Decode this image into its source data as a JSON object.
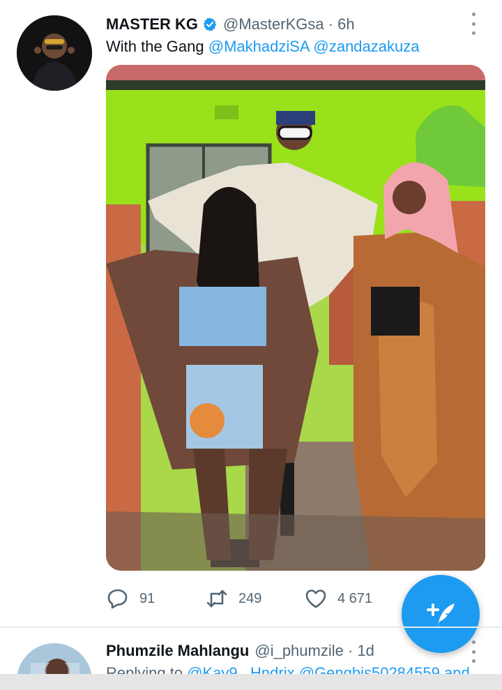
{
  "tweet": {
    "author_name": "MASTER KG",
    "author_handle": "@MasterKGsa · 6h",
    "text_prefix": "With the Gang ",
    "mentions": [
      "@MakhadziSA",
      "@zandazakuza"
    ],
    "stats": {
      "replies": "91",
      "retweets": "249",
      "likes": "4 671"
    }
  },
  "next_tweet": {
    "author_name": "Phumzile Mahlangu",
    "author_handle": "@i_phumzile · 1d",
    "replying_prefix": "Replying to ",
    "replying_to": "@Kay9_ Hndrix @Gengbis50284559 and"
  },
  "colors": {
    "accent": "#1d9bf0",
    "text_primary": "#0f1419",
    "text_secondary": "#536471"
  },
  "icons": {
    "verified": "verified-badge-icon",
    "more": "more-vertical-icon",
    "reply": "comment-icon",
    "retweet": "retweet-icon",
    "like": "heart-icon",
    "compose": "compose-feather-icon"
  }
}
